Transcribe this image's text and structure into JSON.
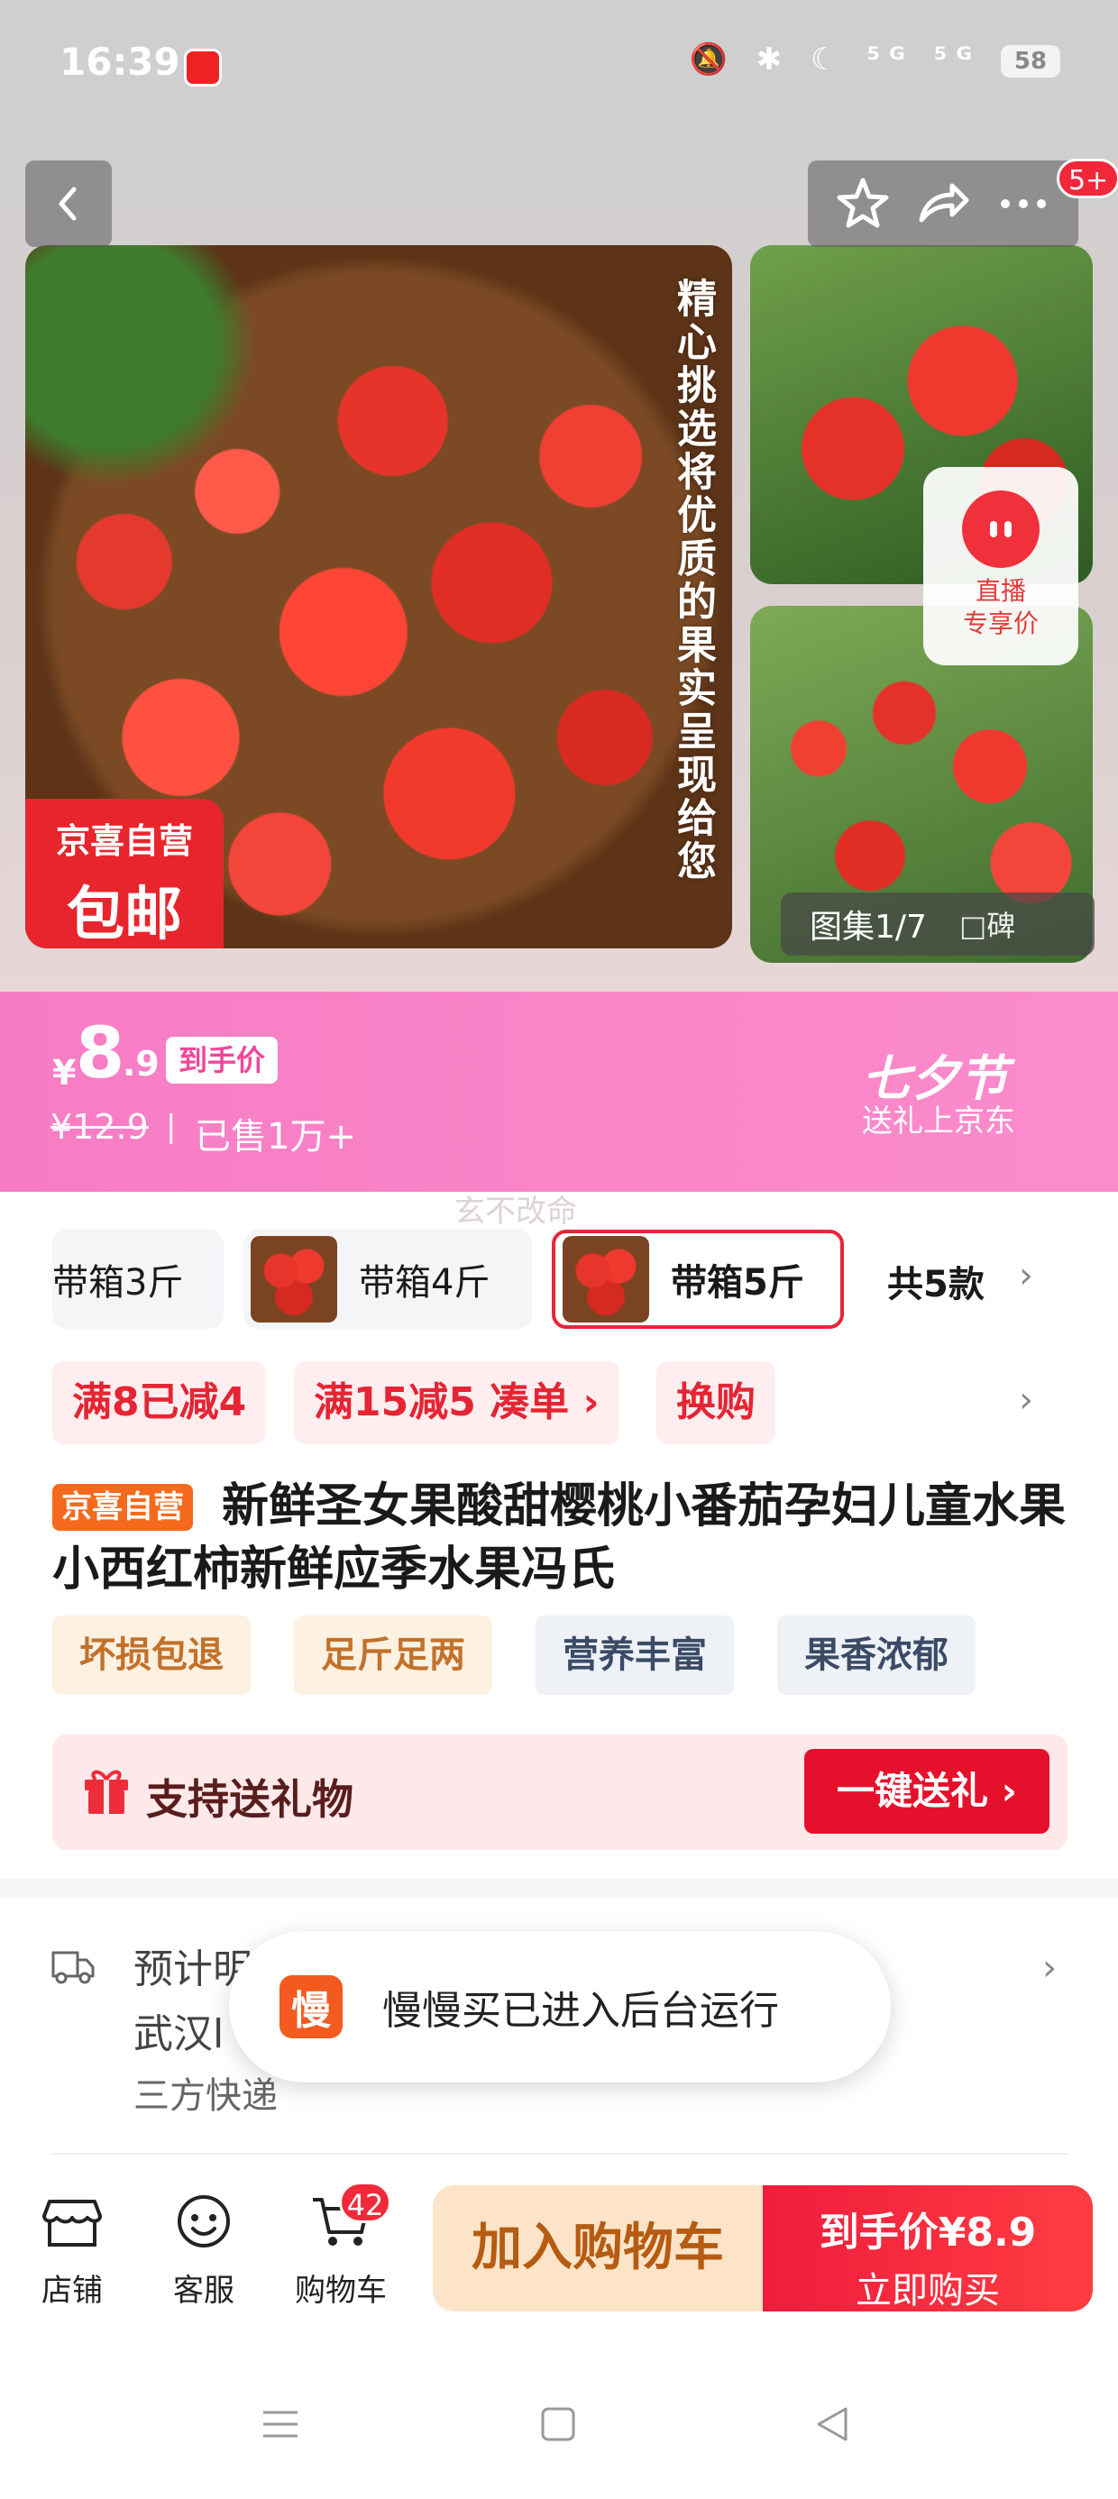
{
  "status_bar": {
    "time": "16:39",
    "icons": "🔕 ✱ ☾ ⁵ᴳ ⁵ᴳ",
    "battery": "58"
  },
  "header": {
    "cart_badge": "5+"
  },
  "gallery": {
    "overlay_text": "精心挑选将优质的果实呈现给您",
    "badge_line1": "京喜自营",
    "badge_line2": "包邮",
    "live_label_line1": "直播",
    "live_label_line2": "专享价",
    "counter": "图集1/7",
    "counter_extra": "□碑"
  },
  "price": {
    "currency": "¥",
    "integer": "8",
    "decimal": ".9",
    "tag": "到手价",
    "original": "¥12.9",
    "separator": "|",
    "sold": "已售1万+",
    "festival_title": "七夕节",
    "festival_sub": "送礼上京东"
  },
  "watermark": "玄不改命",
  "variants": {
    "items": [
      {
        "label": "带箱3斤"
      },
      {
        "label": "带箱4斤"
      },
      {
        "label": "带箱5斤"
      }
    ],
    "count": "共5款",
    "chevron": "›"
  },
  "promotions": {
    "items": [
      "满8已减4",
      "满15减5  凑单 ›",
      "换购"
    ],
    "chevron": "›"
  },
  "product": {
    "self_tag": "京喜自营",
    "title": "新鲜圣女果酸甜樱桃小番茄孕妇儿童水果小西红柿新鲜应季水果冯氏",
    "features": [
      "坏损包退",
      "足斤足两",
      "营养丰富",
      "果香浓郁"
    ]
  },
  "gift": {
    "label": "支持送礼物",
    "button": "一键送礼 ›"
  },
  "delivery": {
    "line1": "预计明",
    "line2": "武汉l",
    "line3": "三方快递",
    "chevron": "›"
  },
  "toast": {
    "icon_char": "慢",
    "text": "慢慢买已进入后台运行"
  },
  "bottom_bar": {
    "store": "店铺",
    "service": "客服",
    "cart": "购物车",
    "cart_count": "42",
    "add_to_cart": "加入购物车",
    "buy_price": "到手价¥8.9",
    "buy_now": "立即购买"
  },
  "colors": {
    "accent": "#e5102b",
    "banner": "#f77cc4",
    "cart_button": "#fde4c8"
  }
}
